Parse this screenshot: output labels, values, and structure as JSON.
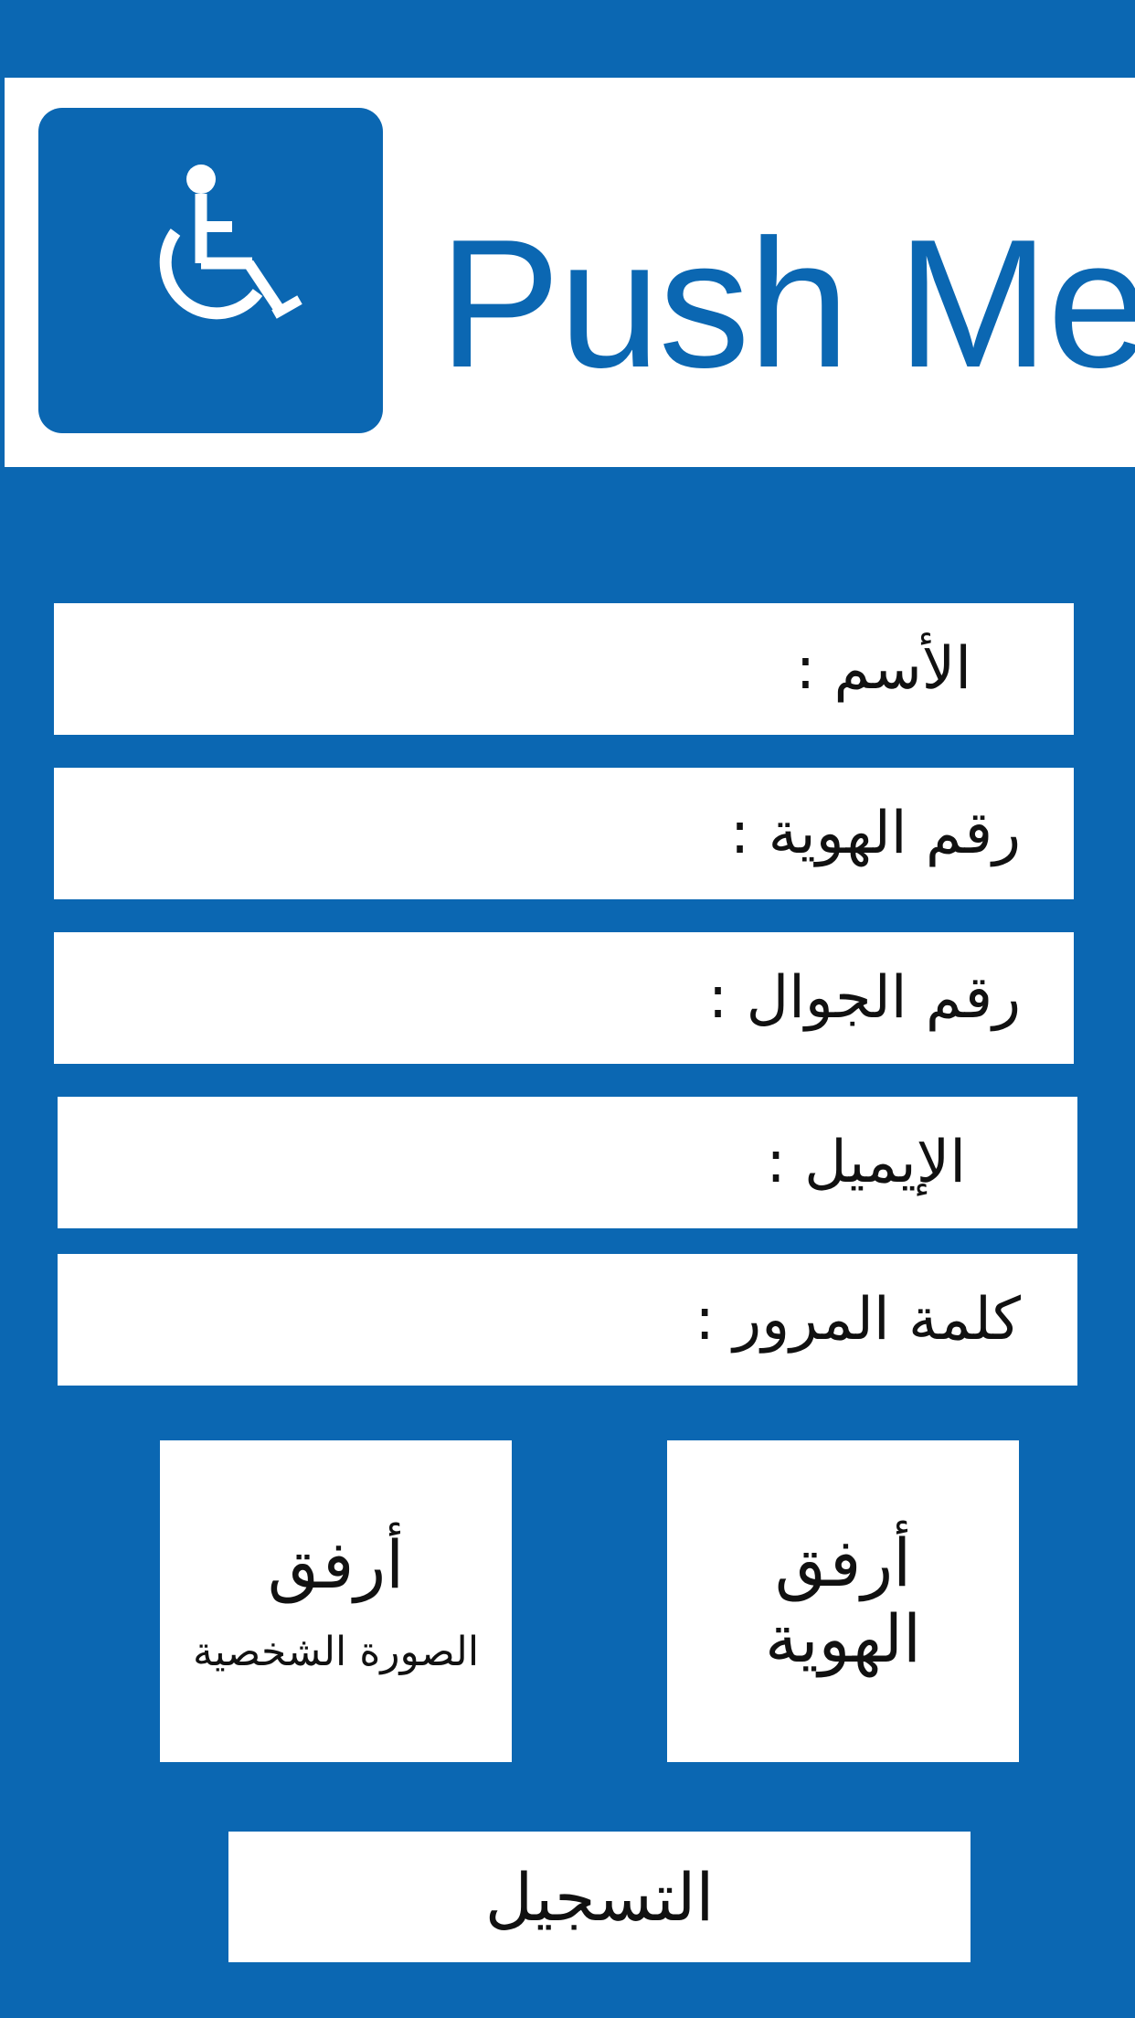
{
  "colors": {
    "brand_blue": "#0b67b2",
    "panel_white": "#ffffff",
    "text_dark": "#111111"
  },
  "header": {
    "logo_icon": "wheelchair-icon",
    "brand_name": "Push Me"
  },
  "form": {
    "fields": [
      {
        "label": "الأسم :"
      },
      {
        "label": "رقم الهوية :"
      },
      {
        "label": "رقم الجوال :"
      },
      {
        "label": "الإيميل :"
      },
      {
        "label": "كلمة المرور :"
      }
    ],
    "attach_photo": {
      "title": "أرفق",
      "subtitle": "الصورة الشخصية"
    },
    "attach_id": {
      "title": "أرفق",
      "subtitle": "الهوية"
    },
    "submit_label": "التسجيل"
  }
}
